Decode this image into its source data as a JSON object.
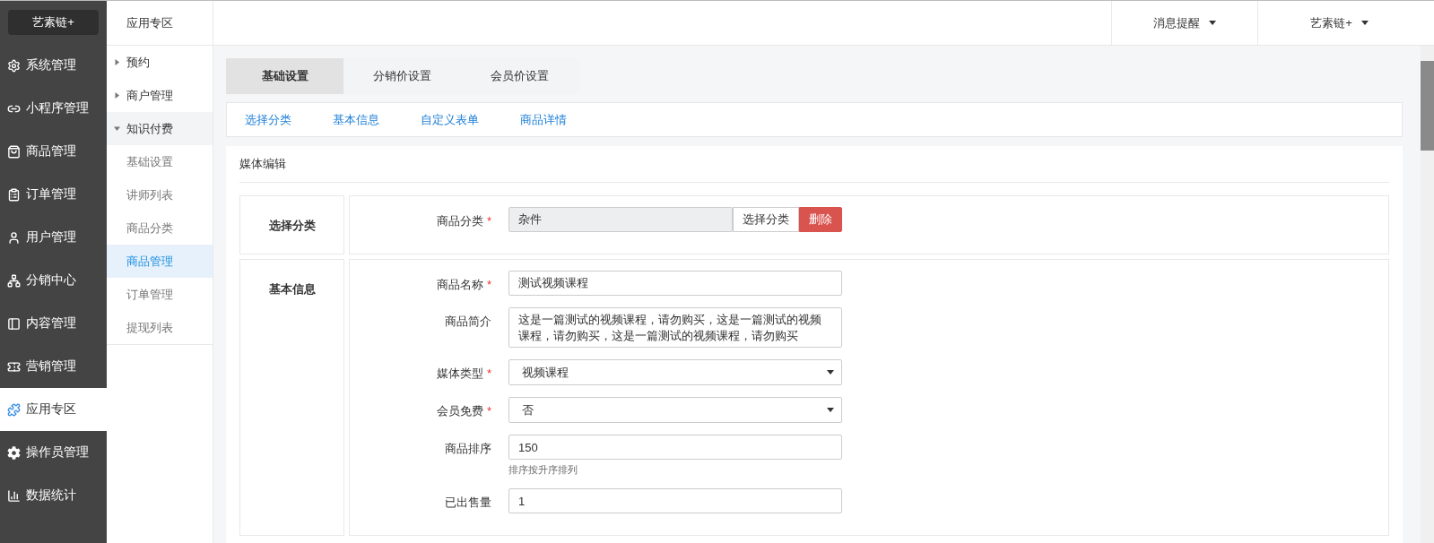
{
  "logo": "艺素链+",
  "nav": [
    {
      "label": "系统管理",
      "selected": false
    },
    {
      "label": "小程序管理",
      "selected": false
    },
    {
      "label": "商品管理",
      "selected": false
    },
    {
      "label": "订单管理",
      "selected": false
    },
    {
      "label": "用户管理",
      "selected": false
    },
    {
      "label": "分销中心",
      "selected": false
    },
    {
      "label": "内容管理",
      "selected": false
    },
    {
      "label": "营销管理",
      "selected": false
    },
    {
      "label": "应用专区",
      "selected": true
    },
    {
      "label": "操作员管理",
      "selected": false
    },
    {
      "label": "数据统计",
      "selected": false
    }
  ],
  "subnav": {
    "title": "应用专区",
    "items": [
      {
        "label": "预约",
        "expanded": false
      },
      {
        "label": "商户管理",
        "expanded": false
      },
      {
        "label": "知识付费",
        "expanded": true,
        "children": [
          {
            "label": "基础设置",
            "selected": false
          },
          {
            "label": "讲师列表",
            "selected": false
          },
          {
            "label": "商品分类",
            "selected": false
          },
          {
            "label": "商品管理",
            "selected": true
          },
          {
            "label": "订单管理",
            "selected": false
          },
          {
            "label": "提现列表",
            "selected": false
          }
        ]
      }
    ]
  },
  "topbar": {
    "menus": [
      "消息提醒",
      "艺素链+"
    ]
  },
  "tabs": [
    {
      "label": "基础设置",
      "selected": true
    },
    {
      "label": "分销价设置",
      "selected": false
    },
    {
      "label": "会员价设置",
      "selected": false
    }
  ],
  "anchors": [
    "选择分类",
    "基本信息",
    "自定义表单",
    "商品详情"
  ],
  "panel": {
    "title": "媒体编辑",
    "sections": [
      {
        "title": "选择分类",
        "fields": [
          {
            "kind": "picker",
            "label": "商品分类",
            "required_mark": "*",
            "value": "杂件",
            "buttons": [
              {
                "label": "选择分类",
                "kind": "default"
              },
              {
                "label": "删除",
                "kind": "danger"
              }
            ]
          }
        ]
      },
      {
        "title": "基本信息",
        "fields": [
          {
            "kind": "text",
            "label": "商品名称",
            "required_mark": "*",
            "value": "测试视频课程"
          },
          {
            "kind": "textarea",
            "label": "商品简介",
            "value": "这是一篇测试的视频课程，请勿购买，这是一篇测试的视频课程，请勿购买，这是一篇测试的视频课程，请勿购买"
          },
          {
            "kind": "select",
            "label": "媒体类型",
            "required_mark": "*",
            "value": "视频课程"
          },
          {
            "kind": "select",
            "label": "会员免费",
            "required_mark": "*",
            "value": "否"
          },
          {
            "kind": "text",
            "label": "商品排序",
            "value": "150",
            "hint": "排序按升序排列"
          },
          {
            "kind": "text",
            "label": "已出售量",
            "value": "1"
          }
        ]
      }
    ]
  }
}
